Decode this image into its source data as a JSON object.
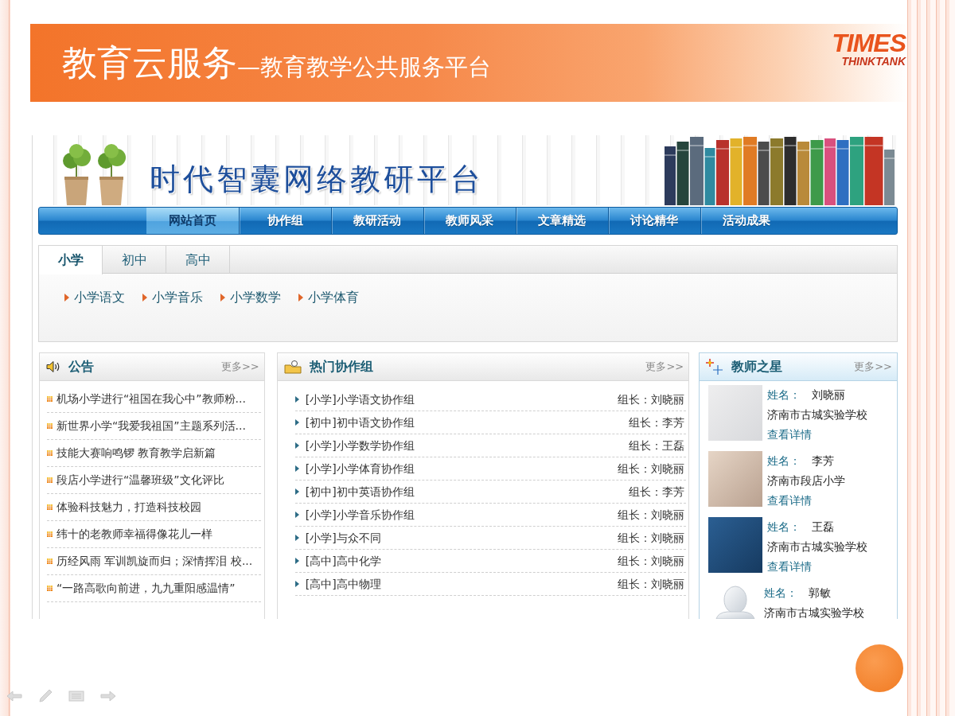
{
  "slide": {
    "title": "教育云服务",
    "subtitle": "—教育教学公共服务平台",
    "logo": {
      "wordmark": "TIMES",
      "tagline": "THINKTANK"
    }
  },
  "site": {
    "title": "时代智囊网络教研平台",
    "nav": [
      {
        "label": "网站首页",
        "selected": true
      },
      {
        "label": "协作组",
        "selected": false
      },
      {
        "label": "教研活动",
        "selected": false
      },
      {
        "label": "教师风采",
        "selected": false
      },
      {
        "label": "文章精选",
        "selected": false
      },
      {
        "label": "讨论精华",
        "selected": false
      },
      {
        "label": "活动成果",
        "selected": false
      }
    ],
    "level_tabs": [
      {
        "label": "小学",
        "selected": true
      },
      {
        "label": "初中",
        "selected": false
      },
      {
        "label": "高中",
        "selected": false
      }
    ],
    "subject_links": [
      "小学语文",
      "小学音乐",
      "小学数学",
      "小学体育"
    ],
    "notices": {
      "title": "公告",
      "more": "更多>>",
      "items": [
        "机场小学进行“祖国在我心中”教师粉...",
        "新世界小学“我爱我祖国”主题系列活...",
        "技能大赛响鸣锣 教育教学启新篇",
        "段店小学进行“温馨班级”文化评比",
        "体验科技魅力，打造科技校园",
        "纬十的老教师幸福得像花儿一样",
        "历经风雨 军训凯旋而归；深情挥泪 校...",
        "“一路高歌向前进，九九重阳感温情”"
      ]
    },
    "groups": {
      "title": "热门协作组",
      "more": "更多>>",
      "items": [
        {
          "name": "[小学]小学语文协作组",
          "leader": "组长：刘晓丽"
        },
        {
          "name": "[初中]初中语文协作组",
          "leader": "组长：李芳"
        },
        {
          "name": "[小学]小学数学协作组",
          "leader": "组长：王磊"
        },
        {
          "name": "[小学]小学体育协作组",
          "leader": "组长：刘晓丽"
        },
        {
          "name": "[初中]初中英语协作组",
          "leader": "组长：李芳"
        },
        {
          "name": "[小学]小学音乐协作组",
          "leader": "组长：刘晓丽"
        },
        {
          "name": "[小学]与众不同",
          "leader": "组长：刘晓丽"
        },
        {
          "name": "[高中]高中化学",
          "leader": "组长：刘晓丽"
        },
        {
          "name": "[高中]高中物理",
          "leader": "组长：刘晓丽"
        }
      ]
    },
    "teachers": {
      "title": "教师之星",
      "more": "更多>>",
      "items": [
        {
          "kind": "photo",
          "name_label": "姓名：",
          "name": "刘晓丽",
          "school": "济南市古城实验学校",
          "details": "查看详情"
        },
        {
          "kind": "photo",
          "name_label": "姓名：",
          "name": "李芳",
          "school": "济南市段店小学",
          "details": "查看详情"
        },
        {
          "kind": "photo",
          "name_label": "姓名：",
          "name": "王磊",
          "school": "济南市古城实验学校",
          "details": "查看详情"
        },
        {
          "kind": "avatar",
          "name_label": "姓名：",
          "name": "郭敏",
          "school": "济南市古城实验学校"
        }
      ]
    }
  }
}
